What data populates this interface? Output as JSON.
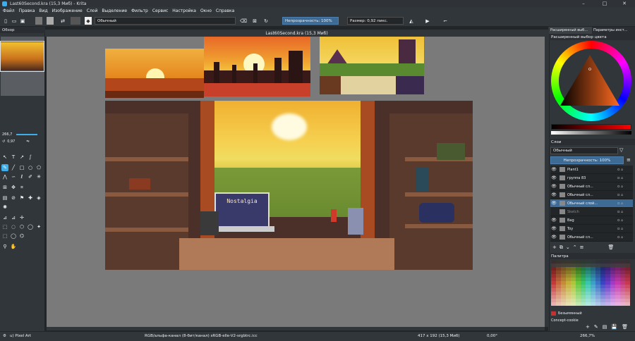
{
  "window": {
    "title": "Last60Second.kra (15,3 Миб) - Krita",
    "minimize": "–",
    "maximize": "□",
    "close": "✕"
  },
  "menu": [
    "Файл",
    "Правка",
    "Вид",
    "Изображение",
    "Слой",
    "Выделение",
    "Фильтр",
    "Сервис",
    "Настройка",
    "Окно",
    "Справка"
  ],
  "toolbar": {
    "blend_mode": "Обычный",
    "opacity": "Непрозрачность: 100%",
    "size": "Размер: 0,92 пикс."
  },
  "left_panel": {
    "overview_title": "Обзор",
    "zoom": "266,7",
    "rotation": "0,97"
  },
  "document_tab": "Last60Second.kra (15,3 Миб)",
  "right_panel": {
    "tabs": [
      "Расширенный выб...",
      "Параметры инст..."
    ],
    "color_dock_title": "Расширенный выбор цвета",
    "layers_title": "Слои",
    "blend_mode": "Обычный",
    "opacity": "Непрозрачность: 100%",
    "layers": [
      {
        "name": "Plant1",
        "selected": false
      },
      {
        "name": "группа 83",
        "selected": false
      },
      {
        "name": "Обычный сл...",
        "selected": false
      },
      {
        "name": "Обычный сл...",
        "selected": false
      },
      {
        "name": "Обычный слой...",
        "selected": true
      },
      {
        "name": "Sketch",
        "selected": false
      },
      {
        "name": "Bag",
        "selected": false
      },
      {
        "name": "Toy",
        "selected": false
      },
      {
        "name": "Обычный сл...",
        "selected": false
      }
    ],
    "palette_title": "Палитра",
    "palette_selected": "Безымянный",
    "palette_name": "Concept-cookie"
  },
  "status": {
    "tool": "u) Pixel Art",
    "colorspace": "RGB/альфа-канал (8-бит/канал)  sRGB-elle-V2-srgbtrc.icc",
    "dims": "417 x 192 (15,3 Миб)",
    "angle": "0,00°",
    "zoom": "266,7%"
  },
  "artwork": {
    "monitor_text": "Nostalgia"
  },
  "colors": {
    "accent": "#3daee9",
    "selection": "#3d6b96",
    "panel": "#31363b"
  }
}
